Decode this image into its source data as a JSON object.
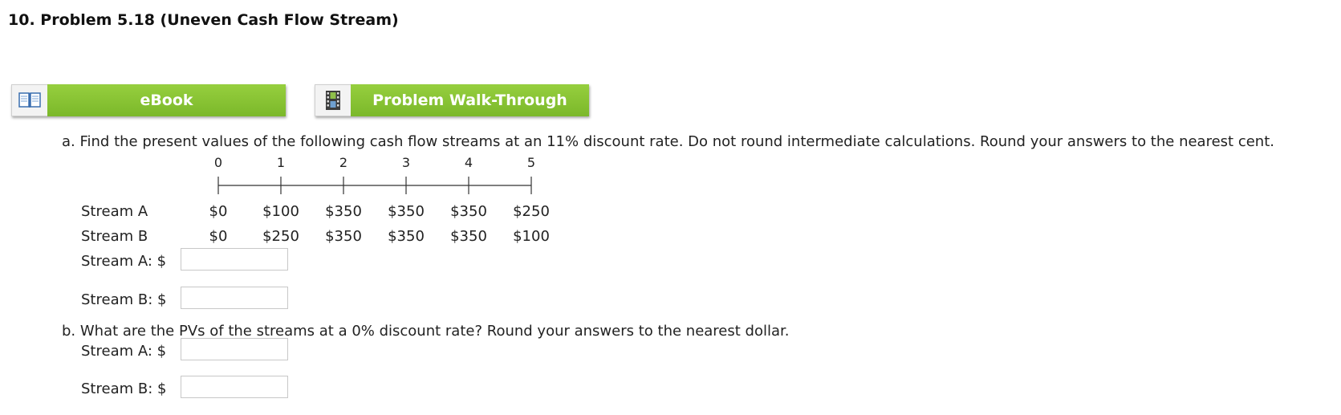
{
  "title": "10.  Problem 5.18 (Uneven Cash Flow Stream)",
  "buttons": {
    "ebook": "eBook",
    "walkthrough": "Problem Walk-Through"
  },
  "part_a": {
    "question": "a. Find the present values of the following cash flow streams at an 11% discount rate. Do not round intermediate calculations. Round your answers to the nearest cent.",
    "periods": [
      "0",
      "1",
      "2",
      "3",
      "4",
      "5"
    ],
    "streams": [
      {
        "name": "Stream A",
        "values": [
          "$0",
          "$100",
          "$350",
          "$350",
          "$350",
          "$250"
        ]
      },
      {
        "name": "Stream B",
        "values": [
          "$0",
          "$250",
          "$350",
          "$350",
          "$350",
          "$100"
        ]
      }
    ],
    "inputs": [
      {
        "label": "Stream A: $",
        "value": ""
      },
      {
        "label": "Stream B: $",
        "value": ""
      }
    ]
  },
  "part_b": {
    "question": "b. What are the PVs of the streams at a 0% discount rate? Round your answers to the nearest dollar.",
    "inputs": [
      {
        "label": "Stream A: $",
        "value": ""
      },
      {
        "label": "Stream B: $",
        "value": ""
      }
    ]
  }
}
